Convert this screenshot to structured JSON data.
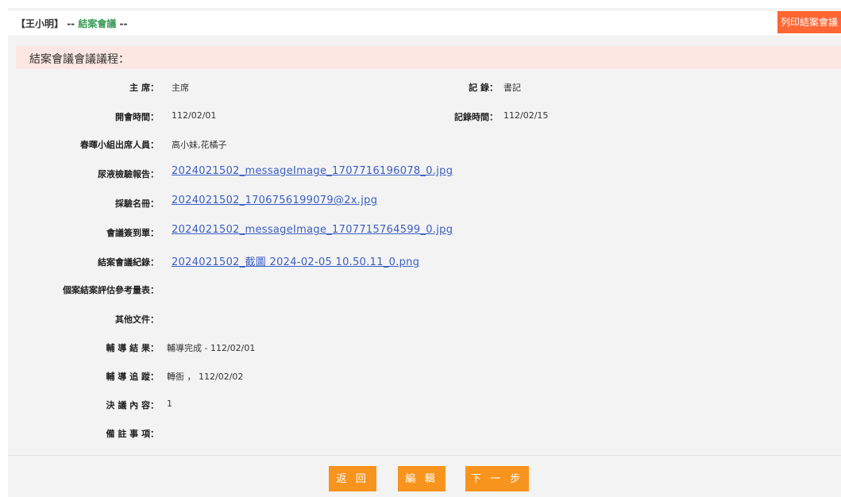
{
  "header": {
    "bracket_name": "【王小明】",
    "sep1": " -- ",
    "page_name": "結案會議",
    "sep2": " --",
    "print_button": "列印結案會議"
  },
  "section_title": "結案會議會議議程：",
  "fields": {
    "chair_label": "主 席：",
    "chair_value": "主席",
    "recorder_label": "記 錄：",
    "recorder_value": "書記",
    "meeting_time_label": "開會時間：",
    "meeting_time_value": "112/02/01",
    "record_time_label": "記錄時間：",
    "record_time_value": "112/02/15",
    "attendees_label": "春暉小組出席人員：",
    "attendees_value": "高小妹,花橘子",
    "urine_report_label": "尿液檢驗報告：",
    "urine_report_file": "2024021502_messageImage_1707716196078_0.jpg",
    "sample_list_label": "採驗名冊：",
    "sample_list_file": "2024021502_1706756199079@2x.jpg",
    "signin_label": "會議簽到單：",
    "signin_file": "2024021502_messageImage_1707715764599_0.jpg",
    "minutes_label": "結案會議紀錄：",
    "minutes_file": "2024021502_截圖 2024-02-05 10.50.11_0.png",
    "assessment_label": "個案結案評估參考量表：",
    "other_docs_label": "其他文件：",
    "counsel_result_label": "輔 導 結 果：",
    "counsel_result_value": "輔導完成 - 112/02/01",
    "counsel_track_label": "輔 導 追 蹤：",
    "counsel_track_value": "轉衙 ， 112/02/02",
    "resolution_label": "決 議 內 容：",
    "resolution_value": "1",
    "remarks_label": "備 註 事 項："
  },
  "buttons": {
    "back": "返 回",
    "edit": "編 輯",
    "next": "下 一 步"
  },
  "colors": {
    "print_button": "#ff6633",
    "action_buttons": "#f7941d",
    "section_title_bg": "#fde7e2",
    "link": "#3b5fc4",
    "breadcrumb_green": "#3a9b54"
  }
}
